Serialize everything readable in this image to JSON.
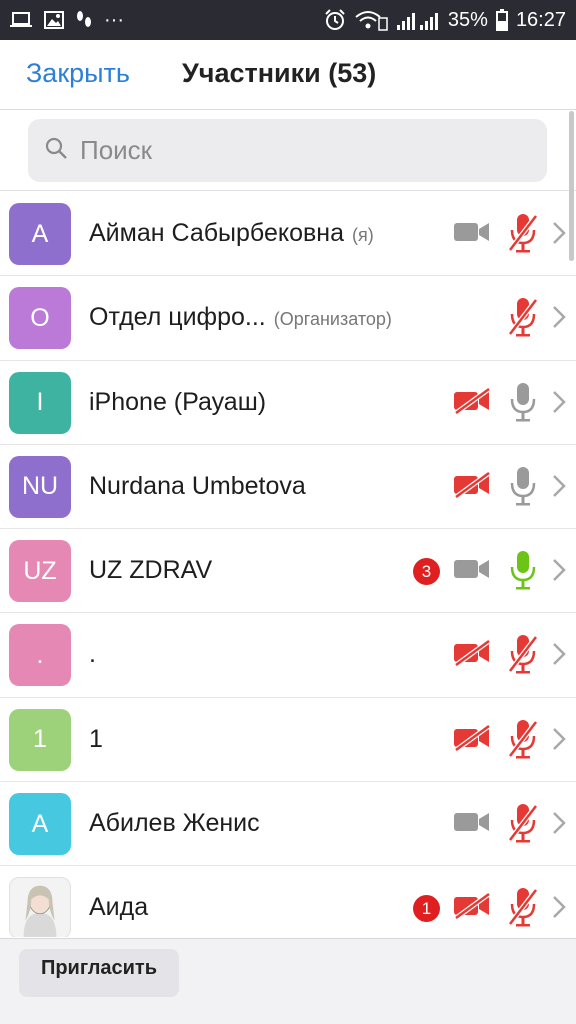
{
  "status_bar": {
    "icons_left": [
      "laptop-icon",
      "image-icon",
      "footprints-icon",
      "more-dots-icon"
    ],
    "dots": "···",
    "icons_right": [
      "alarm-icon",
      "wifi-icon",
      "signal-icon",
      "battery-icon"
    ],
    "battery": "35%",
    "time": "16:27"
  },
  "header": {
    "close_label": "Закрыть",
    "title": "Участники (53)"
  },
  "search": {
    "placeholder": "Поиск",
    "icon": "search-icon"
  },
  "colors": {
    "accent": "#2d7fd8",
    "muted_red": "#e53935",
    "mic_active": "#6cc417",
    "icon_gray": "#9a9a9a"
  },
  "participants": [
    {
      "initials": "А",
      "name": "Айман Сабырбековна",
      "role": "(я)",
      "avatar_color": "#8f6fcd",
      "badge": "",
      "video": "on",
      "mic": "muted"
    },
    {
      "initials": "О",
      "name": "Отдел цифро...",
      "role": "(Организатор)",
      "avatar_color": "#bb7ad8",
      "badge": "",
      "video": "none",
      "mic": "muted"
    },
    {
      "initials": "I",
      "name": "iPhone (Рауаш)",
      "role": "",
      "avatar_color": "#3fb3a2",
      "badge": "",
      "video": "off",
      "mic": "idle"
    },
    {
      "initials": "NU",
      "name": "Nurdana Umbetova",
      "role": "",
      "avatar_color": "#8f6fcd",
      "badge": "",
      "video": "off",
      "mic": "idle"
    },
    {
      "initials": "UZ",
      "name": "UZ ZDRAV",
      "role": "",
      "avatar_color": "#e589b4",
      "badge": "3",
      "video": "on",
      "mic": "active"
    },
    {
      "initials": ".",
      "name": ".",
      "role": "",
      "avatar_color": "#e589b4",
      "badge": "",
      "video": "off",
      "mic": "muted"
    },
    {
      "initials": "1",
      "name": "1",
      "role": "",
      "avatar_color": "#9ed27a",
      "badge": "",
      "video": "off",
      "mic": "muted"
    },
    {
      "initials": "А",
      "name": "Абилев Женис",
      "role": "",
      "avatar_color": "#45c8e0",
      "badge": "",
      "video": "on",
      "mic": "muted"
    },
    {
      "initials": "",
      "name": "Аида",
      "role": "",
      "avatar_color": "photo",
      "badge": "1",
      "video": "off",
      "mic": "muted"
    }
  ],
  "footer": {
    "invite_label": "Пригласить"
  }
}
